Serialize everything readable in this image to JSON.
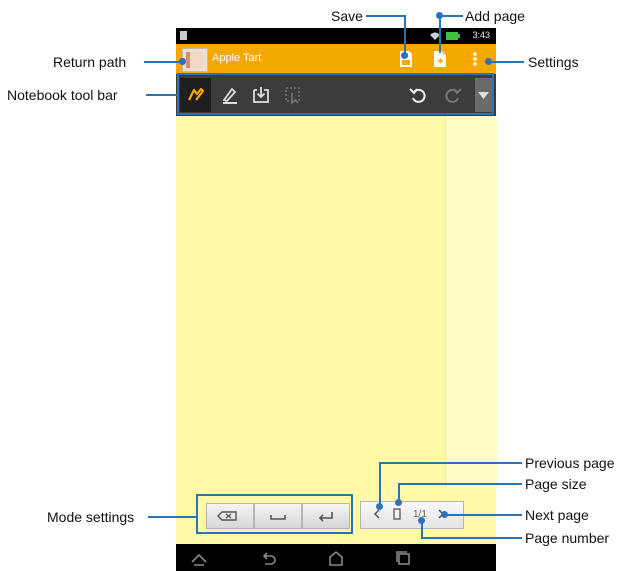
{
  "callouts": {
    "save": "Save",
    "add_page": "Add page",
    "return_path": "Return path",
    "settings": "Settings",
    "notebook_tool_bar": "Notebook tool bar",
    "previous_page": "Previous page",
    "page_size": "Page size",
    "next_page": "Next page",
    "mode_settings": "Mode settings",
    "page_number": "Page number"
  },
  "status_bar": {
    "time": "3:43"
  },
  "title_bar": {
    "notebook_title": "Apple Tart"
  },
  "page_nav": {
    "page_number": "1/1"
  },
  "colors": {
    "accent": "#f5a800",
    "callout_line": "#2a73b8",
    "paper": "#fff9a8"
  },
  "icons": [
    "save-icon",
    "add-page-icon",
    "settings-icon",
    "pen-icon",
    "highlighter-icon",
    "insert-icon",
    "select-icon",
    "undo-icon",
    "redo-icon",
    "dropdown-icon",
    "backspace-icon",
    "space-icon",
    "enter-icon",
    "chevron-left-icon",
    "page-size-icon",
    "chevron-right-icon",
    "back-icon",
    "home-icon",
    "recents-icon"
  ]
}
